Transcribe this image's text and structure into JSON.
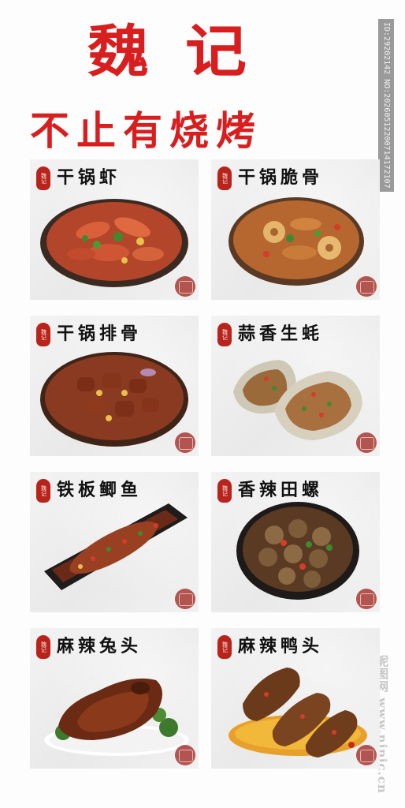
{
  "header": {
    "brand": "魏记",
    "slogan": "不止有烧烤"
  },
  "watermark": {
    "id_text": "ID:29202142 NO:20260512200714172107",
    "site": "昵图网 www.nipic.cn"
  },
  "seal_text": "魏记",
  "dishes": [
    {
      "name": "干锅虾"
    },
    {
      "name": "干锅脆骨"
    },
    {
      "name": "干锅排骨"
    },
    {
      "name": "蒜香生蚝"
    },
    {
      "name": "铁板鲫鱼"
    },
    {
      "name": "香辣田螺"
    },
    {
      "name": "麻辣兔头"
    },
    {
      "name": "麻辣鸭头"
    }
  ],
  "colors": {
    "title_red": "#d81e1e",
    "seal_red": "#b8231c",
    "card_bg": "#ececec"
  }
}
